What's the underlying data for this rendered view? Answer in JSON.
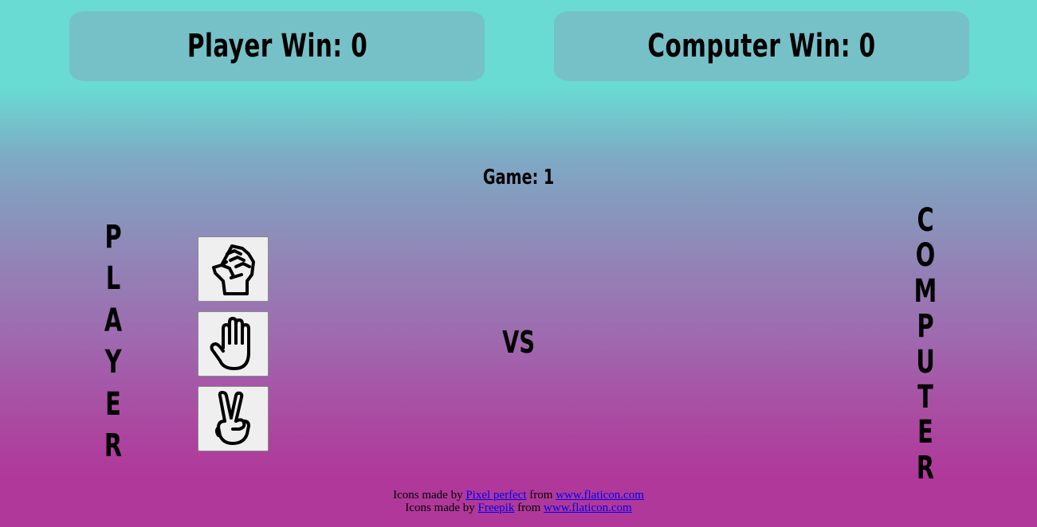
{
  "scoreboard": {
    "player_label": "Player Win: 0",
    "computer_label": "Computer Win: 0"
  },
  "game": {
    "label": "Game: 1",
    "vs_label": "VS"
  },
  "player_side": {
    "letters": [
      "P",
      "L",
      "A",
      "Y",
      "E",
      "R"
    ]
  },
  "computer_side": {
    "letters": [
      "C",
      "O",
      "M",
      "P",
      "U",
      "T",
      "E",
      "R"
    ]
  },
  "choices": [
    {
      "name": "rock",
      "icon": "fist-icon"
    },
    {
      "name": "paper",
      "icon": "open-hand-icon"
    },
    {
      "name": "scissors",
      "icon": "peace-hand-icon"
    }
  ],
  "credits": {
    "line1": {
      "prefix": "Icons made by ",
      "author": "Pixel perfect",
      "middle": " from ",
      "site": "www.flaticon.com"
    },
    "line2": {
      "prefix": "Icons made by ",
      "author": "Freepik",
      "middle": " from ",
      "site": "www.flaticon.com"
    }
  },
  "colors": {
    "background_top": "#69dbd2",
    "background_bottom": "#b0389a",
    "score_box": "#76c1c8",
    "button_bg": "#efefef",
    "link": "#0000ee"
  }
}
